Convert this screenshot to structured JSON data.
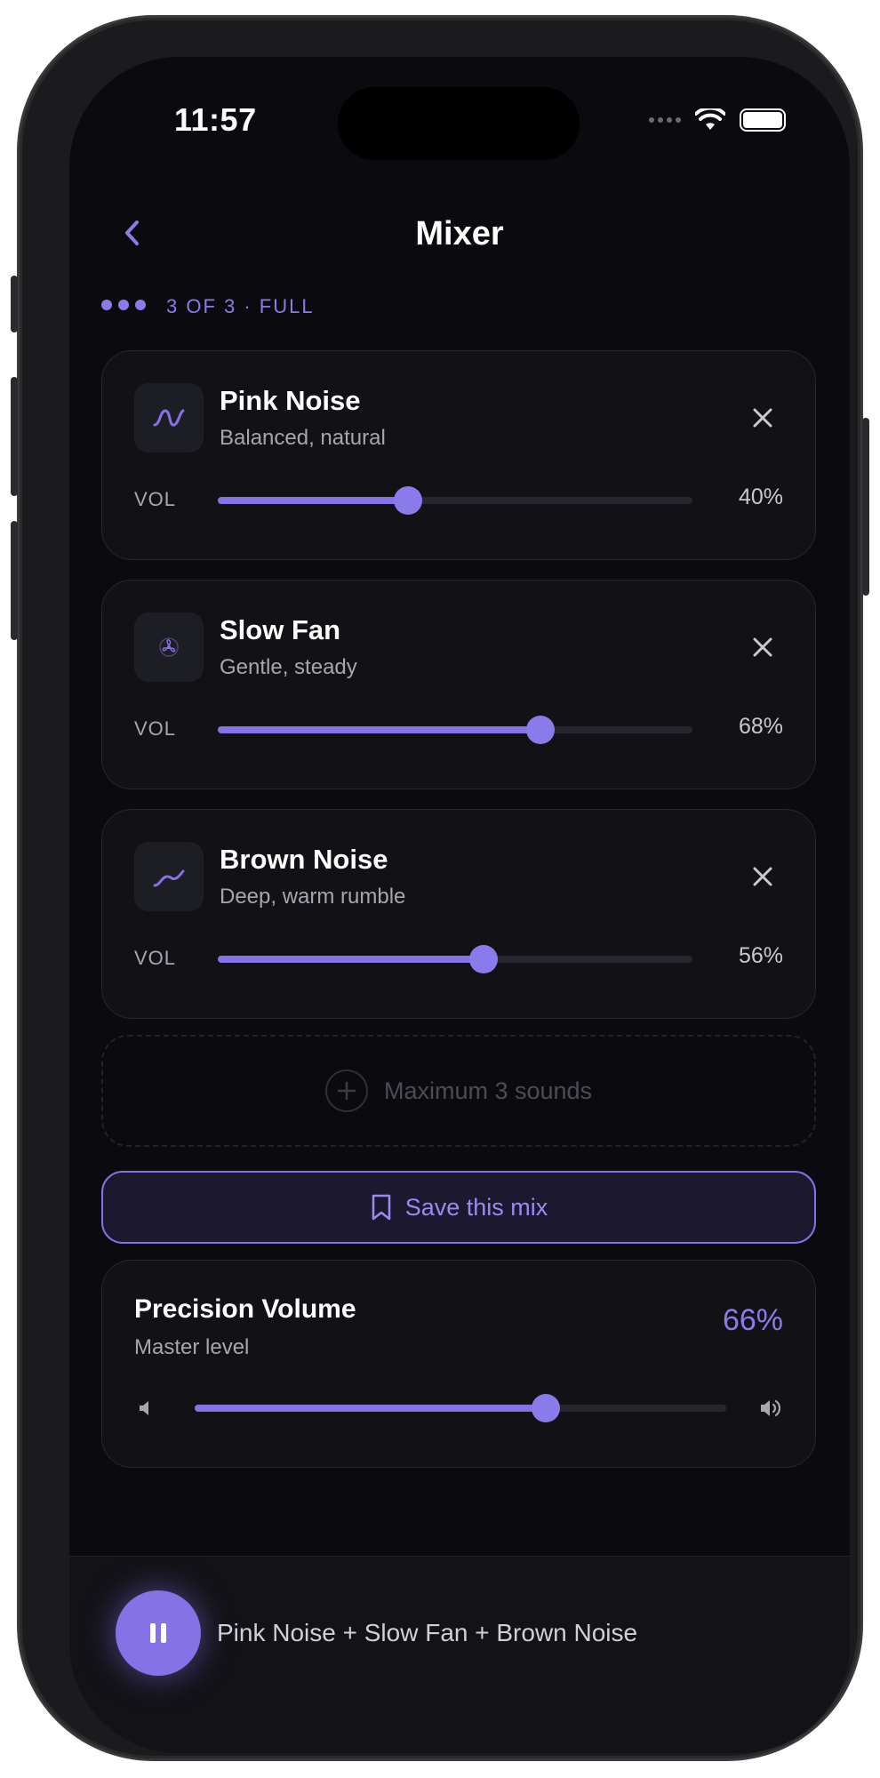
{
  "status": {
    "time": "11:57"
  },
  "header": {
    "title": "Mixer"
  },
  "counter": {
    "text": "3 OF 3 · FULL"
  },
  "sounds": [
    {
      "name": "Pink Noise",
      "description": "Balanced, natural",
      "vol_label": "VOL",
      "volume": 40,
      "volume_text": "40%",
      "icon": "wave-icon"
    },
    {
      "name": "Slow Fan",
      "description": "Gentle, steady",
      "vol_label": "VOL",
      "volume": 68,
      "volume_text": "68%",
      "icon": "fan-icon"
    },
    {
      "name": "Brown Noise",
      "description": "Deep, warm rumble",
      "vol_label": "VOL",
      "volume": 56,
      "volume_text": "56%",
      "icon": "rumble-icon"
    }
  ],
  "add_slot": {
    "text": "Maximum 3 sounds"
  },
  "save": {
    "label": "Save this mix"
  },
  "master": {
    "title": "Precision Volume",
    "subtitle": "Master level",
    "volume": 66,
    "volume_text": "66%"
  },
  "now_playing": {
    "text": "Pink Noise + Slow Fan + Brown Noise",
    "state": "playing"
  },
  "colors": {
    "accent": "#8472e6",
    "background": "#0b0b0f",
    "card": "#121216"
  }
}
